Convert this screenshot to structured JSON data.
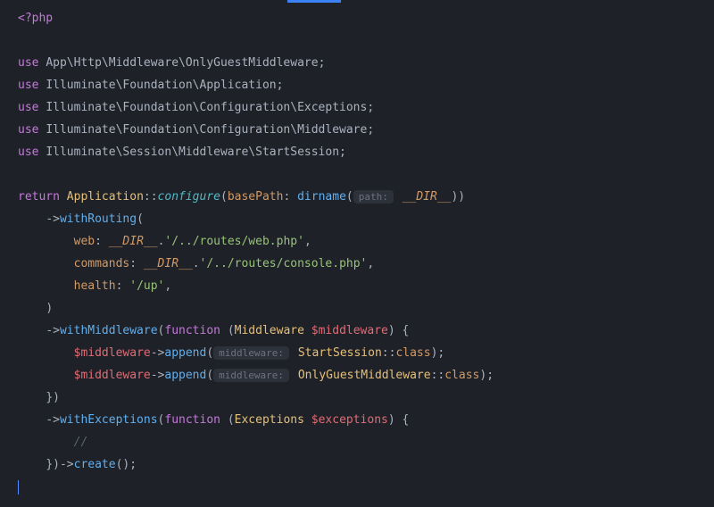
{
  "open_tag": "<?php",
  "uses": [
    "App\\Http\\Middleware\\OnlyGuestMiddleware",
    "Illuminate\\Foundation\\Application",
    "Illuminate\\Foundation\\Configuration\\Exceptions",
    "Illuminate\\Foundation\\Configuration\\Middleware",
    "Illuminate\\Session\\Middleware\\StartSession"
  ],
  "kw": {
    "use": "use ",
    "return": "return ",
    "function": "function "
  },
  "configure": {
    "class": "Application",
    "method": "configure",
    "param": "basePath",
    "fn": "dirname",
    "hint": "path:",
    "magic": "__DIR__"
  },
  "routing": {
    "method": "withRouting",
    "web": {
      "name": "web",
      "magic": "__DIR__",
      "path": "'/../routes/web.php'"
    },
    "commands": {
      "name": "commands",
      "magic": "__DIR__",
      "path": "'/../routes/console.php'"
    },
    "health": {
      "name": "health",
      "path": "'/up'"
    }
  },
  "middleware": {
    "method": "withMiddleware",
    "paramType": "Middleware",
    "paramVar": "$middleware",
    "calls": [
      {
        "var": "$middleware",
        "chain": "append",
        "hint": "middleware:",
        "target": "StartSession",
        "const": "class"
      },
      {
        "var": "$middleware",
        "chain": "append",
        "hint": "middleware:",
        "target": "OnlyGuestMiddleware",
        "const": "class"
      }
    ]
  },
  "exceptions": {
    "method": "withExceptions",
    "paramType": "Exceptions",
    "paramVar": "$exceptions",
    "comment": "//"
  },
  "create": "create",
  "p": {
    "semi": ";",
    "dcolon": "::",
    "lpar": "(",
    "rpar": ")",
    "arrow": "->",
    "colon": ": ",
    "colon2": ":",
    "comma": ",",
    "dot": ".",
    "lbr": "{",
    "rbr": "}",
    "rpar_semi": ");",
    "rpar_rpar": "))",
    "rbr_rpar": "})",
    "rpar_sp_lbr": ") {"
  }
}
